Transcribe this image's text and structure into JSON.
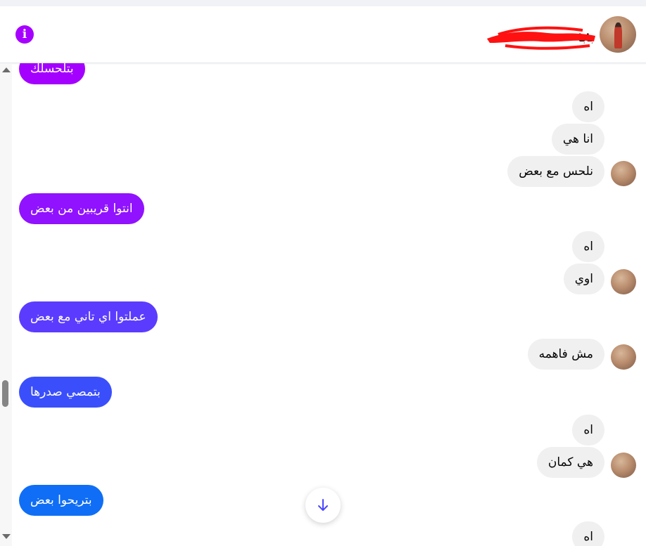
{
  "header": {
    "contact_name": "بابا",
    "info_icon": "info-icon",
    "accent_color": "#a600ff"
  },
  "messages": [
    {
      "id": "m1",
      "side": "out",
      "text": "بتلحسلك",
      "color": "#a300ff"
    },
    {
      "id": "m2",
      "side": "in",
      "text": "اه"
    },
    {
      "id": "m3",
      "side": "in",
      "text": "انا هي"
    },
    {
      "id": "m4",
      "side": "in",
      "text": "نلحس مع بعض",
      "avatar": true
    },
    {
      "id": "m5",
      "side": "out",
      "text": "انتوا قريبين من بعض",
      "color": "#9012fe"
    },
    {
      "id": "m6",
      "side": "in",
      "text": "اه"
    },
    {
      "id": "m7",
      "side": "in",
      "text": "اوي",
      "avatar": true
    },
    {
      "id": "m8",
      "side": "out",
      "text": "عملتوا اي تاني مع بعض",
      "color": "#5b3cff"
    },
    {
      "id": "m9",
      "side": "in",
      "text": "مش فاهمه",
      "avatar": true
    },
    {
      "id": "m10",
      "side": "out",
      "text": "بتمصي صدرها",
      "color": "#3a4ffb"
    },
    {
      "id": "m11",
      "side": "in",
      "text": "اه"
    },
    {
      "id": "m12",
      "side": "in",
      "text": "هي كمان",
      "avatar": true
    },
    {
      "id": "m13",
      "side": "out",
      "text": "بتريحوا بعض",
      "color": "#0f6ef5"
    },
    {
      "id": "m14",
      "side": "in",
      "text": "اه"
    }
  ],
  "controls": {
    "scroll_down_icon": "arrow-down-icon",
    "scroll_down_color": "#4a47ff"
  }
}
